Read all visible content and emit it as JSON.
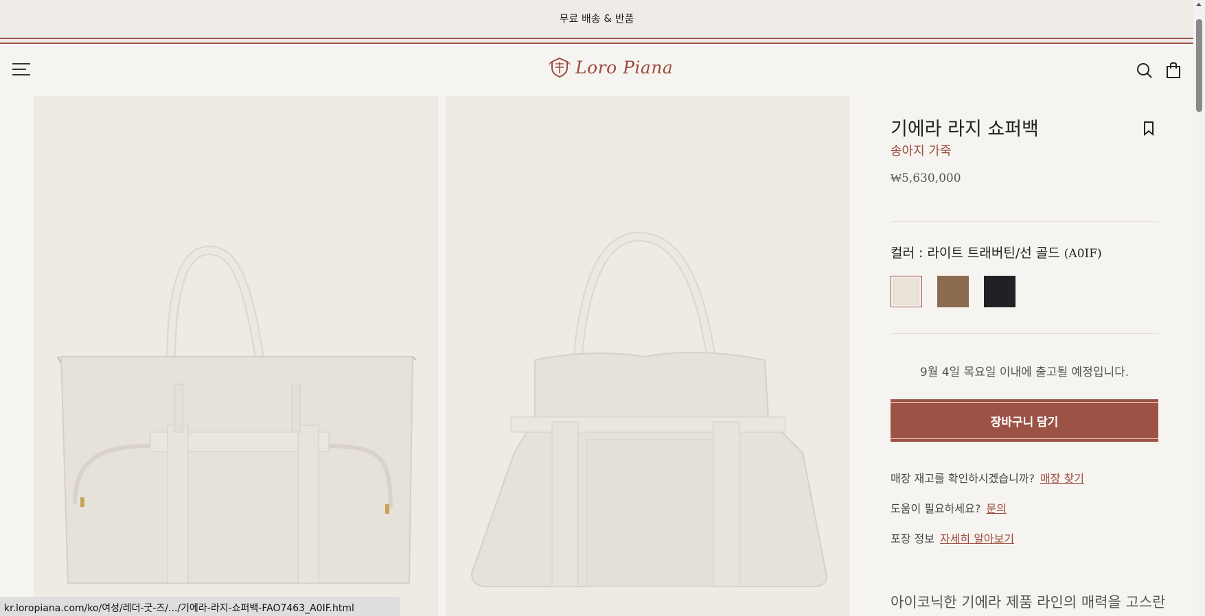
{
  "announcement": {
    "text": "무료 배송 & 반품"
  },
  "header": {
    "logo_text": "Loro Piana",
    "menu_icon": "hamburger-icon",
    "search_icon": "search-icon",
    "bag_icon": "shopping-bag-icon"
  },
  "product": {
    "title": "기에라 라지 쇼퍼백",
    "material": "송아지 가죽",
    "price": "₩5,630,000",
    "color_label": "컬러 : 라이트 트래버틴/선 골드",
    "color_code": "(A0IF)",
    "swatches": [
      {
        "name": "라이트 트래버틴",
        "color": "#e9e3da",
        "selected": true
      },
      {
        "name": "brown",
        "color": "#8b6a4e",
        "selected": false
      },
      {
        "name": "black",
        "color": "#1f2124",
        "selected": false
      }
    ],
    "shipping_note": "9월 4일 목요일 이내에 출고될 예정입니다.",
    "add_to_cart": "장바구니 담기",
    "store_question": "매장 재고를 확인하시겠습니까?",
    "store_link": "매장 찾기",
    "help_question": "도움이 필요하세요?",
    "help_link": "문의",
    "packaging_label": "포장 정보",
    "packaging_link": "자세히 알아보기",
    "description": "아이코닉한 기에라 제품 라인의 매력을 고스란"
  },
  "colors": {
    "accent": "#9c4a3d",
    "button": "#9c5244",
    "background": "#f6f4f0",
    "bag": "#e6e1d9"
  },
  "status_bar": {
    "url": "kr.loropiana.com/ko/여성/레더-굿-즈/.../기에라-라지-쇼퍼백-FAO7463_A0IF.html"
  }
}
